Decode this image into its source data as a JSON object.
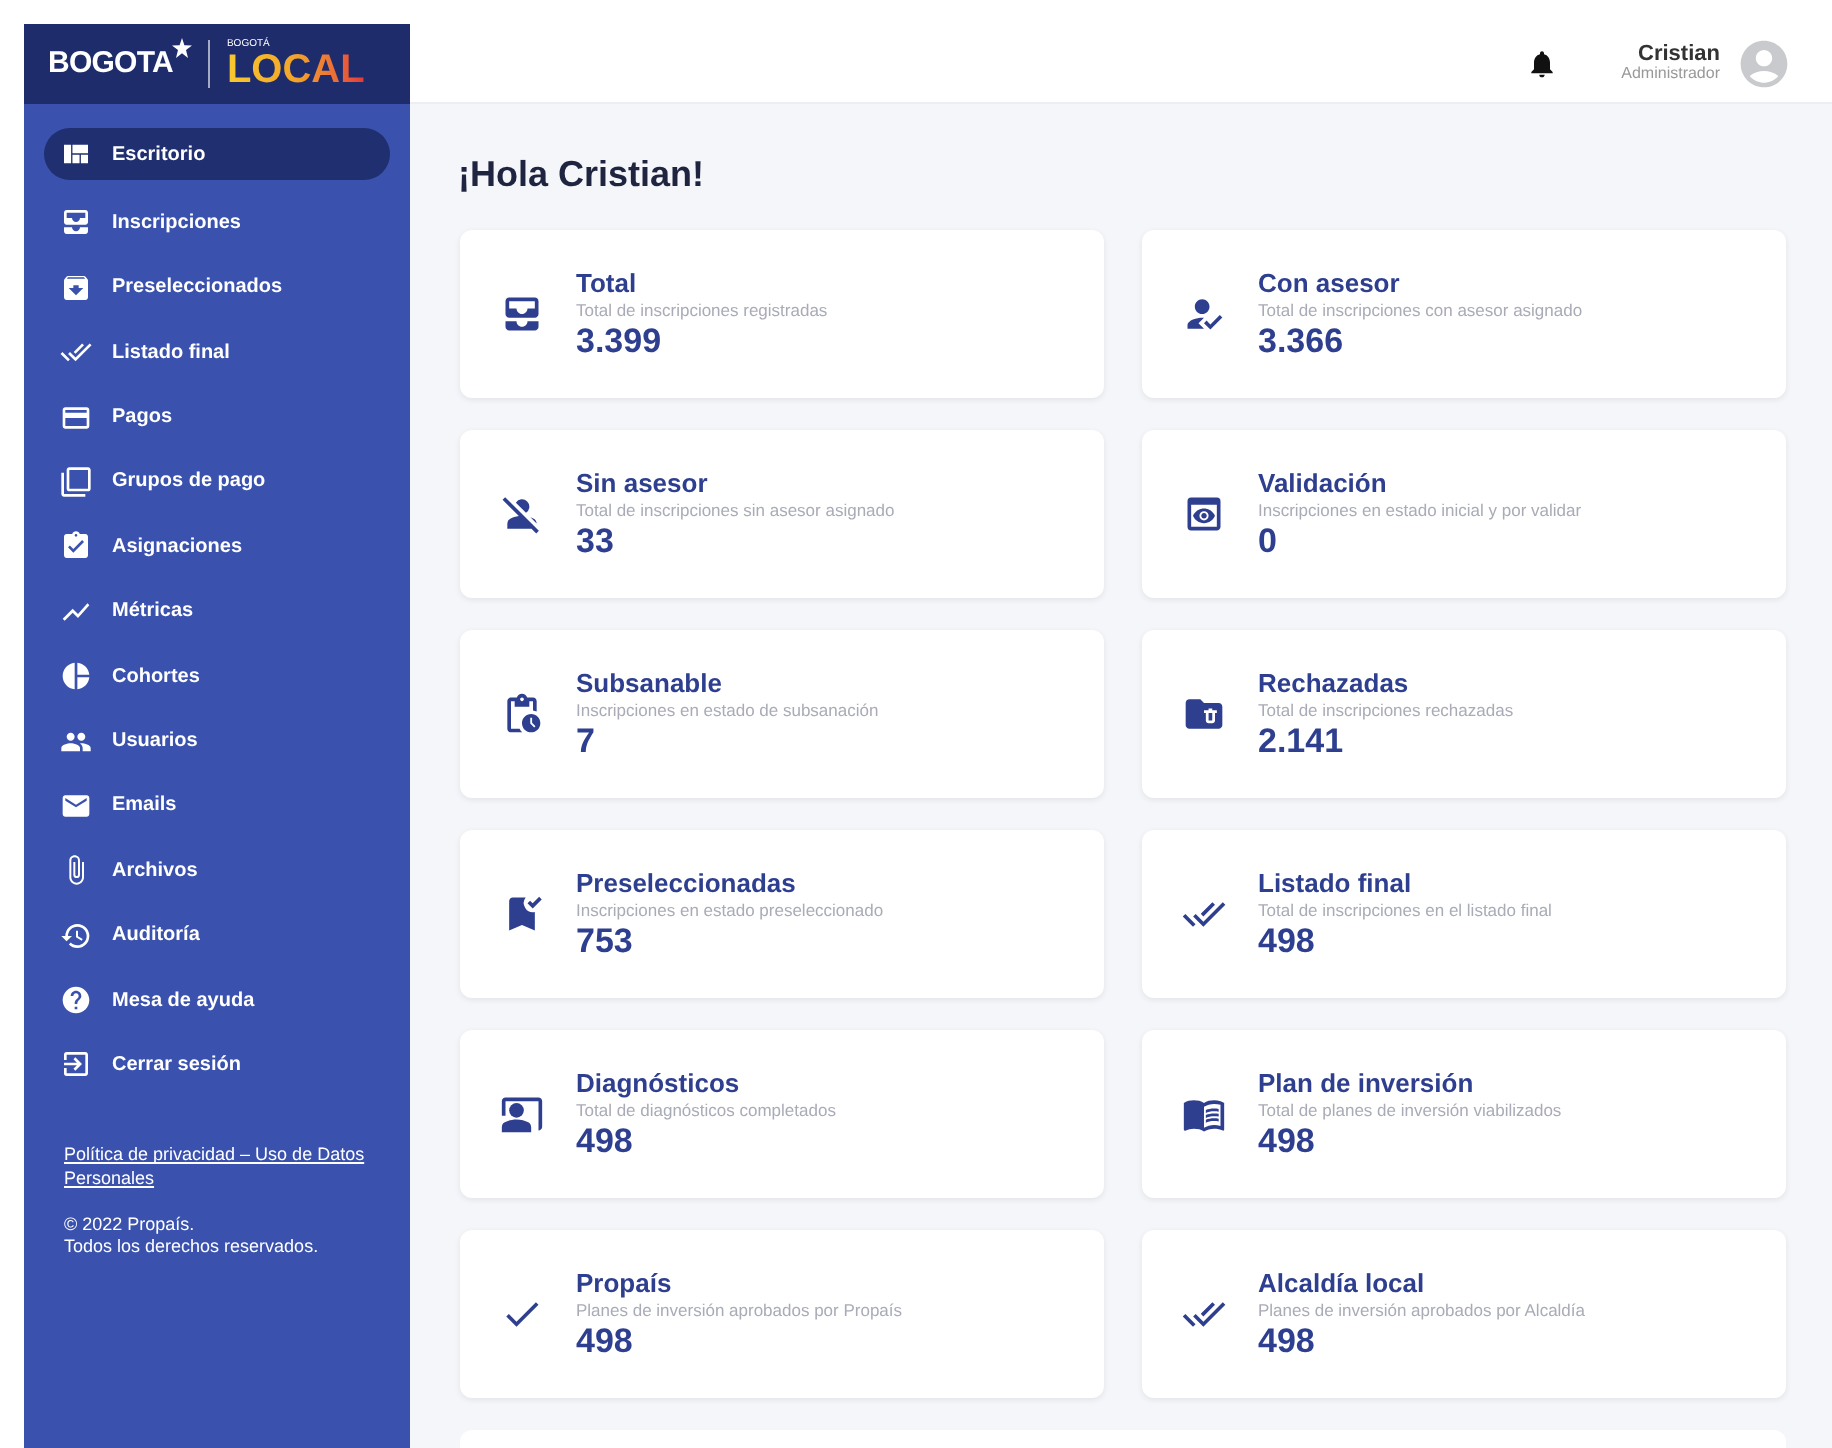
{
  "logo": {
    "city": "BOGOTA",
    "small": "BOGOTÁ",
    "brand": "LOCAL"
  },
  "sidebar": {
    "items": [
      {
        "label": "Escritorio",
        "selected": true
      },
      {
        "label": "Inscripciones",
        "selected": false
      },
      {
        "label": "Preseleccionados",
        "selected": false
      },
      {
        "label": "Listado final",
        "selected": false
      },
      {
        "label": "Pagos",
        "selected": false
      },
      {
        "label": "Grupos de pago",
        "selected": false
      },
      {
        "label": "Asignaciones",
        "selected": false
      },
      {
        "label": "Métricas",
        "selected": false
      },
      {
        "label": "Cohortes",
        "selected": false
      },
      {
        "label": "Usuarios",
        "selected": false
      },
      {
        "label": "Emails",
        "selected": false
      },
      {
        "label": "Archivos",
        "selected": false
      },
      {
        "label": "Auditoría",
        "selected": false
      },
      {
        "label": "Mesa de ayuda",
        "selected": false
      },
      {
        "label": "Cerrar sesión",
        "selected": false
      }
    ],
    "privacy_link": "Política de privacidad – Uso de Datos Personales",
    "copyright": [
      "© 2022 Propaís.",
      "Todos los derechos reservados."
    ]
  },
  "header": {
    "user_name": "Cristian",
    "user_role": "Administrador"
  },
  "greeting": "¡Hola Cristian!",
  "cards": [
    {
      "title": "Total",
      "description": "Total de inscripciones registradas",
      "value": "3.399"
    },
    {
      "title": "Con asesor",
      "description": "Total de inscripciones con asesor asignado",
      "value": "3.366"
    },
    {
      "title": "Sin asesor",
      "description": "Total de inscripciones sin asesor asignado",
      "value": "33"
    },
    {
      "title": "Validación",
      "description": "Inscripciones en estado inicial y por validar",
      "value": "0"
    },
    {
      "title": "Subsanable",
      "description": "Inscripciones en estado de subsanación",
      "value": "7"
    },
    {
      "title": "Rechazadas",
      "description": "Total de inscripciones rechazadas",
      "value": "2.141"
    },
    {
      "title": "Preseleccionadas",
      "description": "Inscripciones en estado preseleccionado",
      "value": "753"
    },
    {
      "title": "Listado final",
      "description": "Total de inscripciones en el listado final",
      "value": "498"
    },
    {
      "title": "Diagnósticos",
      "description": "Total de diagnósticos completados",
      "value": "498"
    },
    {
      "title": "Plan de inversión",
      "description": "Total de planes de inversión viabilizados",
      "value": "498"
    },
    {
      "title": "Propaís",
      "description": "Planes de inversión aprobados por Propaís",
      "value": "498"
    },
    {
      "title": "Alcaldía local",
      "description": "Planes de inversión aprobados por Alcaldía",
      "value": "498"
    }
  ]
}
